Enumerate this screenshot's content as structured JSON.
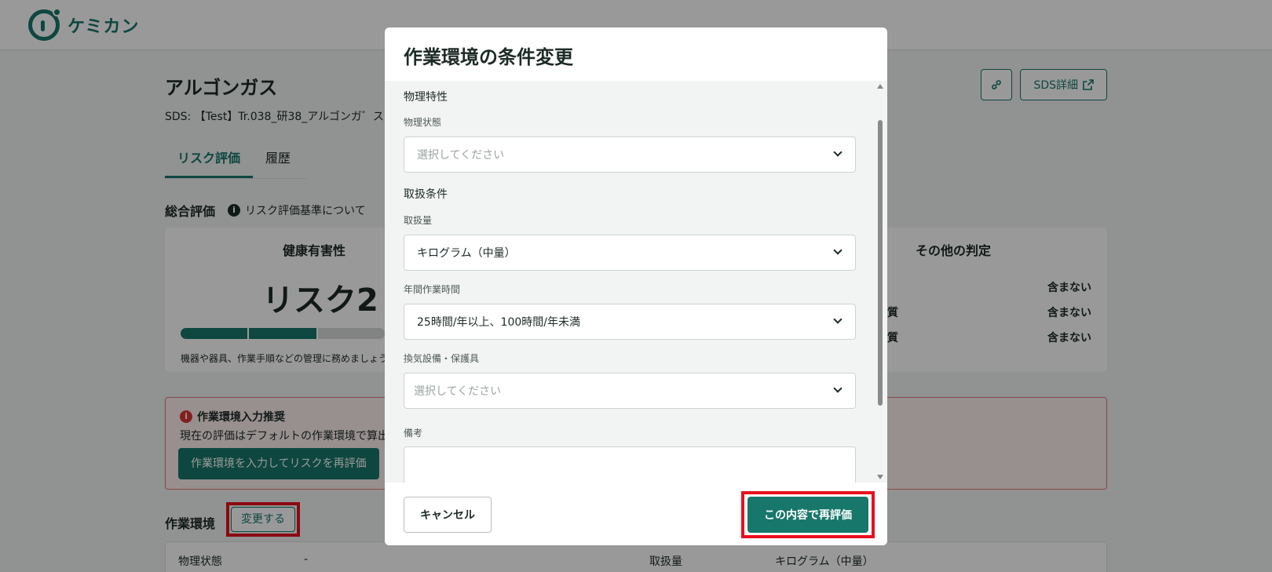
{
  "app": {
    "logo_text": "ケミカン"
  },
  "substance": {
    "title": "アルゴンガス",
    "sds_label": "SDS:",
    "sds_value": "【Test】Tr.038_研38_アルゴンガ゛ス",
    "link_icon": "link-icon",
    "sds_detail_label": "SDS詳細"
  },
  "tabs": [
    {
      "label": "リスク評価",
      "active": true
    },
    {
      "label": "履歴",
      "active": false
    }
  ],
  "overall": {
    "title": "総合評価",
    "criteria_link": "リスク評価基準について",
    "health_title": "健康有害性",
    "risk_text": "リスク2",
    "risk_level": 2,
    "risk_level_max": 3,
    "note": "機器や器具、作業手順などの管理に務めましょう",
    "other_title": "その他の判定",
    "other_rows": [
      {
        "label": "",
        "value": "含まない"
      },
      {
        "label": "物質",
        "value": "含まない"
      },
      {
        "label": "物質",
        "value": "含まない"
      }
    ]
  },
  "alert": {
    "title": "作業環境入力推奨",
    "body": "現在の評価はデフォルトの作業環境で算出",
    "button": "作業環境を入力してリスクを再評価"
  },
  "environment": {
    "label": "作業環境",
    "change_button": "変更する",
    "rows": [
      {
        "label": "物理状態",
        "value": "-"
      },
      {
        "label": "取扱量",
        "value": "キログラム（中量）"
      }
    ]
  },
  "modal": {
    "title": "作業環境の条件変更",
    "physical_group": "物理特性",
    "physical_state_label": "物理状態",
    "physical_state_placeholder": "選択してください",
    "handling_group": "取扱条件",
    "amount_label": "取扱量",
    "amount_value": "キログラム（中量）",
    "hours_label": "年間作業時間",
    "hours_value": "25時間/年以上、100時間/年未満",
    "ventilation_label": "換気設備・保護具",
    "ventilation_placeholder": "選択してください",
    "notes_label": "備考",
    "cancel_label": "キャンセル",
    "submit_label": "この内容で再評価"
  },
  "colors": {
    "accent": "#17776b",
    "highlight": "#e8101e",
    "alert_bg": "#fdeeee"
  }
}
